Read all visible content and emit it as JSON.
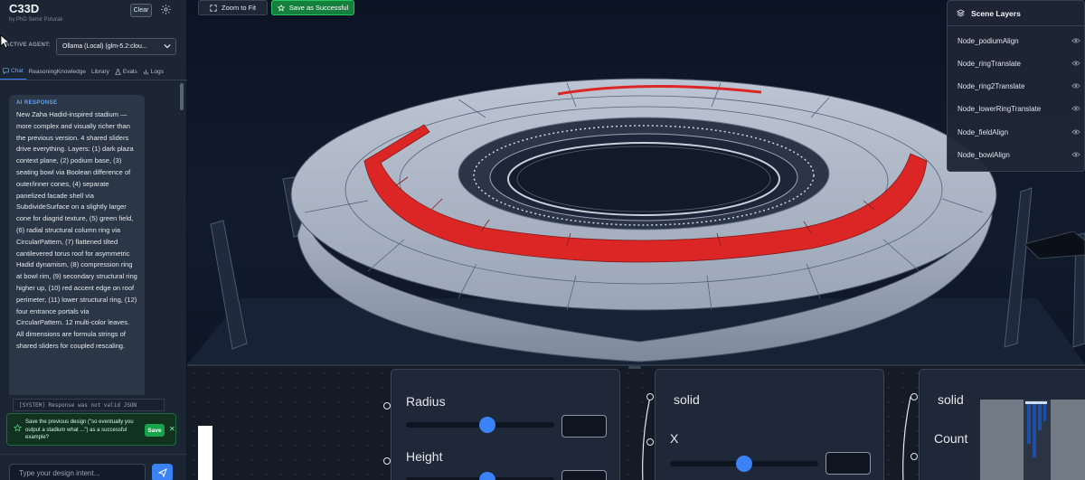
{
  "app": {
    "title": "C33D",
    "subtitle": "by PhD Semir Poturak",
    "clear_label": "Clear"
  },
  "agent": {
    "label": "ACTIVE AGENT:",
    "selected": "Ollama (Local) (glm-5.2:clou..."
  },
  "tabs": [
    {
      "label": "Chat",
      "icon": "chat-icon"
    },
    {
      "label": "Reasoning",
      "icon": ""
    },
    {
      "label": "Knowledge",
      "icon": ""
    },
    {
      "label": "Library",
      "icon": "book-icon"
    },
    {
      "label": "Evals",
      "icon": "flask-icon"
    },
    {
      "label": "Logs",
      "icon": "bars-icon"
    }
  ],
  "message": {
    "label": "AI RESPONSE",
    "body": "New Zaha Hadid-inspired stadium — more complex and visually richer than the previous version. 4 shared sliders drive everything. Layers: (1) dark plaza context plane, (2) podium base, (3) seating bowl via Boolean difference of outer/inner cones, (4) separate panelized facade shell via SubdivideSurface on a slightly larger cone for diagrid texture, (5) green field, (6) radial structural column ring via CircularPattern, (7) flattened tilted cantilevered torus roof for asymmetric Hadid dynamism, (8) compression ring at bowl rim, (9) secondary structural ring higher up, (10) red accent edge on roof perimeter, (11) lower structural ring, (12) four entrance portals via CircularPattern. 12 multi-color leaves. All dimensions are formula strings of shared sliders for coupled rescaling."
  },
  "system_line": "[SYSTEM] Response was not valid JSON",
  "toast": {
    "text": "Save the previous design (\"so eventually you output a stadium what ...\") as a successful example?",
    "save_label": "Save",
    "close_label": "✕"
  },
  "chat_input": {
    "placeholder": "Type your design intent..."
  },
  "toolbar": {
    "zoom_label": "Zoom to Fit",
    "success_label": "Save as Successful"
  },
  "layers": {
    "title": "Scene Layers",
    "items": [
      "Node_podiumAlign",
      "Node_ringTranslate",
      "Node_ring2Translate",
      "Node_lowerRingTranslate",
      "Node_fieldAlign",
      "Node_bowlAlign"
    ]
  },
  "nodes": {
    "n1": {
      "field1": "Radius",
      "field2": "Height",
      "slider1": 0.55,
      "slider2": 0.55
    },
    "n2": {
      "title": "solid",
      "field1": "X",
      "slider1": 0.5
    },
    "n3": {
      "title": "solid",
      "field1": "Count"
    }
  },
  "colors": {
    "accent": "#3b82f6",
    "success": "#15803d",
    "roof_accent": "#dc2626",
    "structure": "#a9b3c4"
  }
}
